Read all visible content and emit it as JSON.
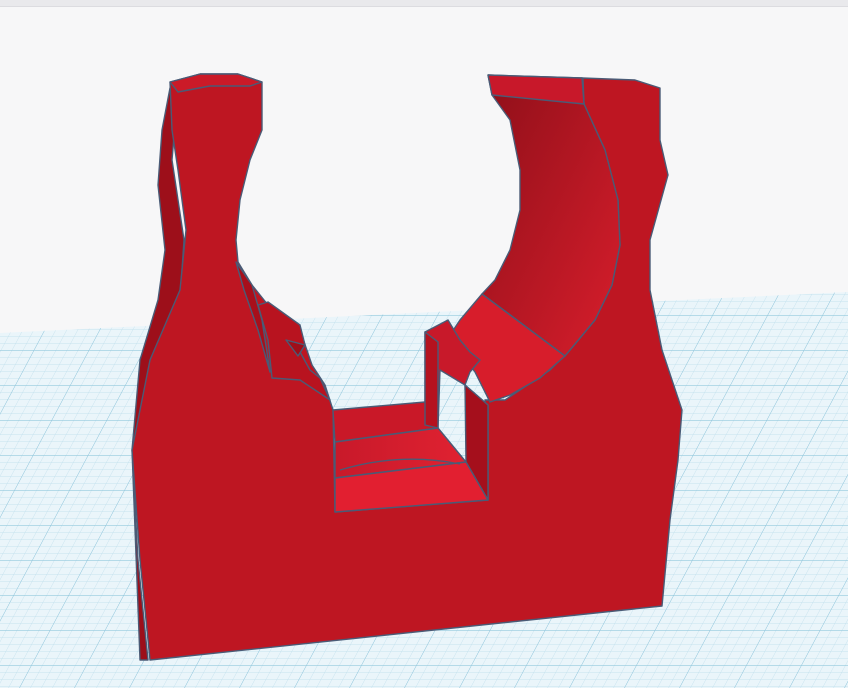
{
  "viewport": {
    "background_color": "#f7f7f8",
    "grid_color": "#a9d4e4",
    "grid_major_color": "#86bfd6",
    "model_color": "#be1622",
    "model_edge_color": "#4a5b76"
  },
  "scene": {
    "object": "pipe-clip-icon",
    "workplane": "workplane-grid-icon"
  }
}
